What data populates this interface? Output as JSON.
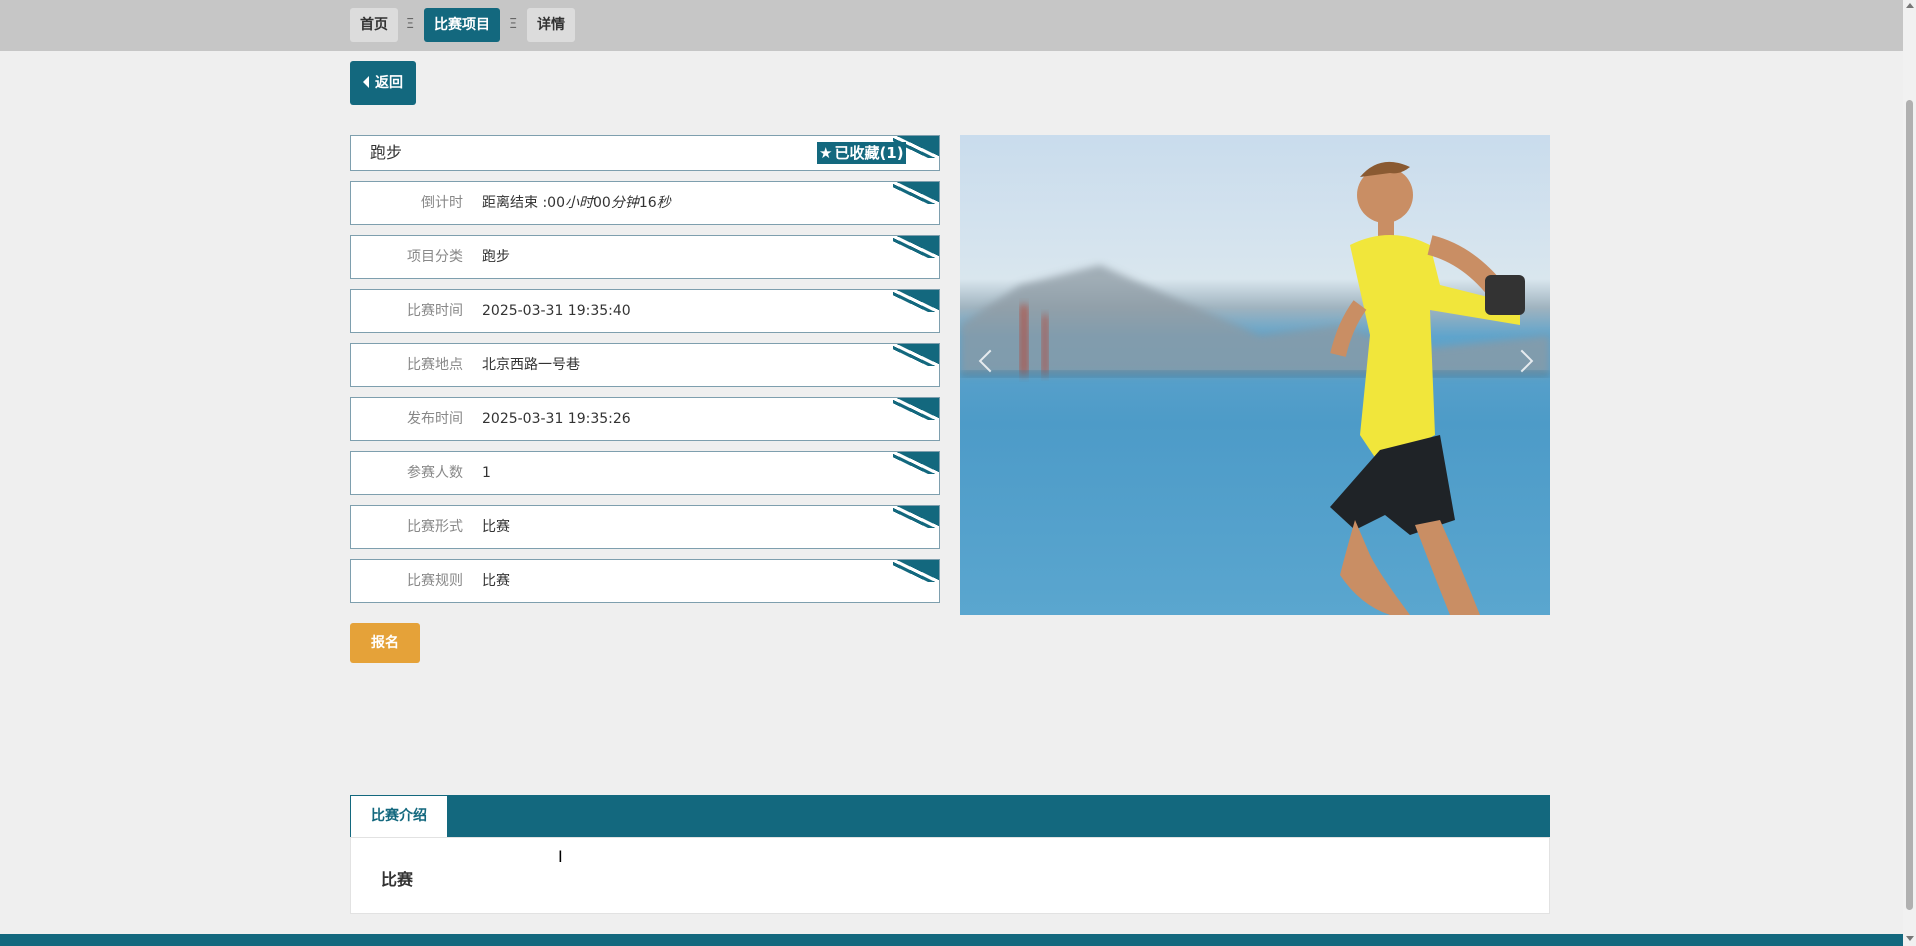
{
  "breadcrumb": {
    "home": "首页",
    "sep1": "Ξ",
    "current": "比赛项目",
    "sep2": "Ξ",
    "detail": "详情"
  },
  "back_button": "返回",
  "title": "跑步",
  "favorite": {
    "star": "★",
    "label": "已收藏(1)"
  },
  "fields": [
    {
      "label": "倒计时",
      "value_prefix": "距离结束 :00",
      "value_italic": "小时",
      "value_mid": "00",
      "value_italic2": "分钟",
      "value_mid2": "16",
      "value_italic3": "秒"
    },
    {
      "label": "项目分类",
      "value": "跑步"
    },
    {
      "label": "比赛时间",
      "value": "2025-03-31 19:35:40"
    },
    {
      "label": "比赛地点",
      "value": "北京西路一号巷"
    },
    {
      "label": "发布时间",
      "value": "2025-03-31 19:35:26"
    },
    {
      "label": "参赛人数",
      "value": "1"
    },
    {
      "label": "比赛形式",
      "value": "比赛"
    },
    {
      "label": "比赛规则",
      "value": "比赛"
    }
  ],
  "signup_button": "报名",
  "tabs": [
    {
      "label": "比赛介绍"
    }
  ],
  "intro_text": "比赛",
  "colors": {
    "primary": "#13687e",
    "accent": "#e5a239",
    "background": "#efefef"
  },
  "icons": {
    "back": "caret-left-icon",
    "favorite": "star-icon",
    "prev": "chevron-left-icon",
    "next": "chevron-right-icon"
  }
}
